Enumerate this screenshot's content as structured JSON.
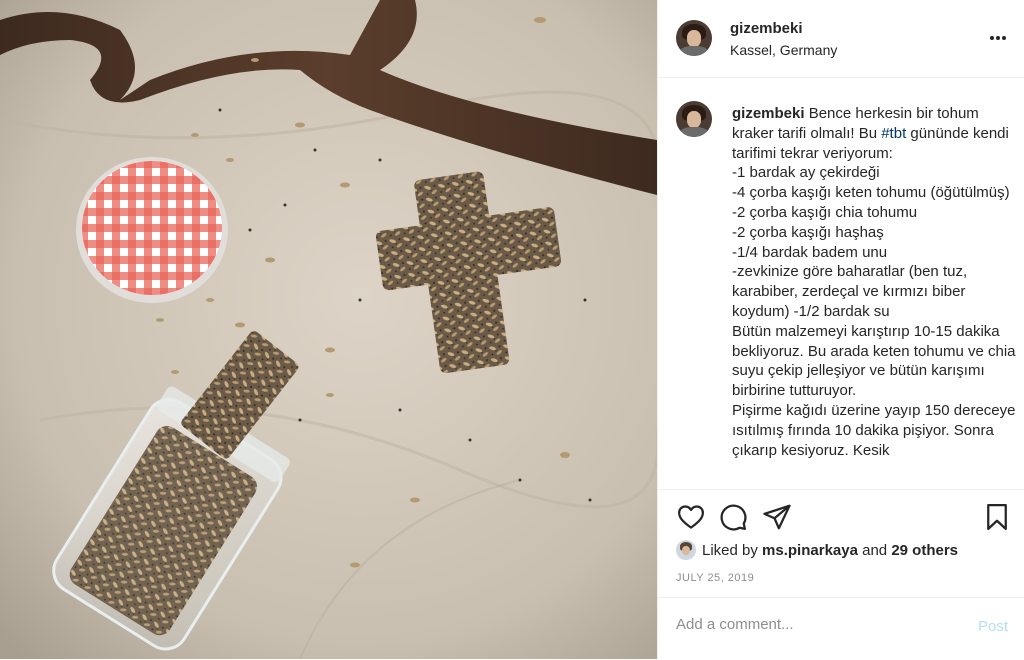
{
  "post": {
    "username": "gizembeki",
    "location": "Kassel, Germany",
    "caption_intro": "Bence herkesin bir tohum kraker tarifi olmalı! Bu ",
    "hashtag": "#tbt",
    "caption_body": " gününde kendi tarifimi tekrar veriyorum:\n-1 bardak ay çekirdeği\n-4 çorba kaşığı keten tohumu (öğütülmüş)\n-2 çorba kaşığı chia tohumu\n-2 çorba kaşığı haşhaş\n-1/4 bardak badem unu\n-zevkinize göre baharatlar (ben tuz, karabiber, zerdeçal ve kırmızı biber koydum) -1/2 bardak su\nBütün malzemeyi karıştırıp 10-15 dakika bekliyoruz. Bu arada keten tohumu ve chia suyu çekip jelleşiyor ve bütün karışımı birbirine tutturuyor.\nPişirme kağıdı üzerine yayıp 150 dereceye ısıtılmış fırında 10 dakika pişiyor. Sonra çıkarıp kesiyoruz. Kesik",
    "liked_by_prefix": "Liked by ",
    "liked_by_user": "ms.pinarkaya",
    "liked_by_and": " and ",
    "liked_by_others": "29 others",
    "date": "JULY 25, 2019"
  },
  "comment": {
    "placeholder": "Add a comment...",
    "post_label": "Post"
  },
  "icons": {
    "more": "more-horizontal-icon",
    "like": "heart-icon",
    "comment": "comment-bubble-icon",
    "share": "paper-plane-icon",
    "save": "bookmark-icon"
  },
  "colors": {
    "hashtag": "#00376b",
    "post_button": "#b2dffc",
    "date": "#8e8e8e"
  }
}
